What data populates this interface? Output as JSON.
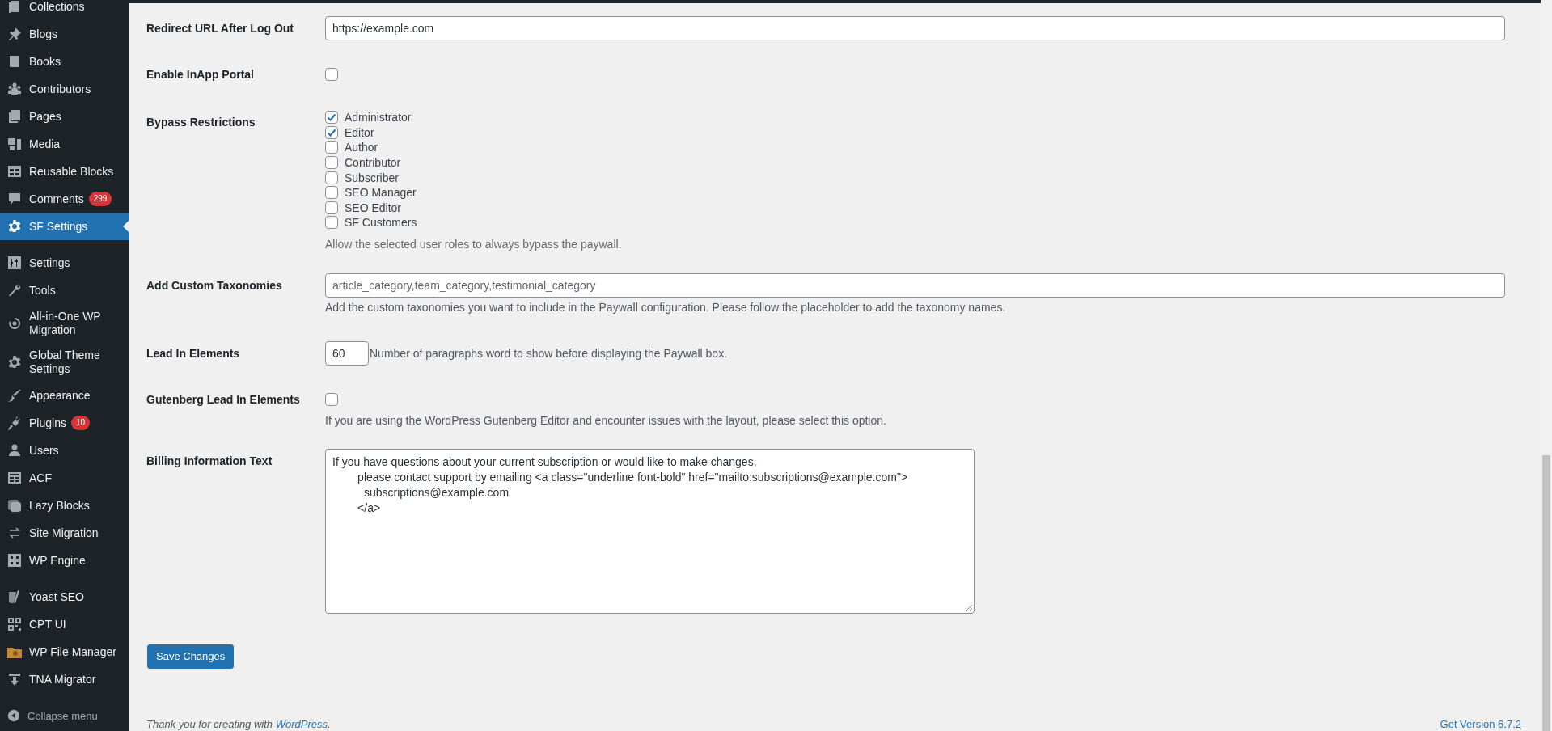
{
  "sidebar": {
    "sections": [
      {
        "items": [
          {
            "label": "Collections",
            "selected": false
          },
          {
            "label": "Blogs",
            "selected": false
          },
          {
            "label": "Books",
            "selected": false
          },
          {
            "label": "Contributors",
            "selected": false
          },
          {
            "label": "Pages",
            "selected": false
          },
          {
            "label": "Media",
            "selected": false
          },
          {
            "label": "Reusable Blocks",
            "selected": false
          },
          {
            "label": "Comments",
            "selected": false,
            "badge": "299"
          },
          {
            "label": "SF Settings",
            "selected": true
          }
        ]
      },
      {
        "items": [
          {
            "label": "Settings",
            "selected": false
          },
          {
            "label": "Tools",
            "selected": false
          },
          {
            "label": "All-in-One WP Migration",
            "selected": false
          },
          {
            "label": "Global Theme Settings",
            "selected": false
          },
          {
            "label": "Appearance",
            "selected": false
          },
          {
            "label": "Plugins",
            "selected": false,
            "badge": "10"
          },
          {
            "label": "Users",
            "selected": false
          },
          {
            "label": "ACF",
            "selected": false
          },
          {
            "label": "Lazy Blocks",
            "selected": false
          },
          {
            "label": "Site Migration",
            "selected": false
          },
          {
            "label": "WP Engine",
            "selected": false
          }
        ]
      },
      {
        "items": [
          {
            "label": "Yoast SEO",
            "selected": false
          },
          {
            "label": "CPT UI",
            "selected": false
          },
          {
            "label": "WP File Manager",
            "selected": false
          },
          {
            "label": "TNA Migrator",
            "selected": false
          }
        ]
      }
    ],
    "collapse_label": "Collapse menu"
  },
  "form": {
    "rows": [
      {
        "kind": "text",
        "label": "Redirect URL After Log Out",
        "value": "https://example.com"
      },
      {
        "kind": "checkbox",
        "label": "Enable InApp Portal",
        "checked": false
      },
      {
        "kind": "checklist",
        "label": "Bypass Restrictions",
        "options": [
          {
            "label": "Administrator",
            "checked": true
          },
          {
            "label": "Editor",
            "checked": true
          },
          {
            "label": "Author",
            "checked": false
          },
          {
            "label": "Contributor",
            "checked": false
          },
          {
            "label": "Subscriber",
            "checked": false
          },
          {
            "label": "SEO Manager",
            "checked": false
          },
          {
            "label": "SEO Editor",
            "checked": false
          },
          {
            "label": "SF Customers",
            "checked": false
          }
        ],
        "description": "Allow the selected user roles to always bypass the paywall."
      },
      {
        "kind": "text",
        "label": "Add Custom Taxonomies",
        "placeholder": "article_category,team_category,testimonial_category",
        "description": "Add the custom taxonomies you want to include in the Paywall configuration. Please follow the placeholder to add the taxonomy names."
      },
      {
        "kind": "number",
        "label": "Lead In Elements",
        "value": "60",
        "description": "Number of paragraphs word to show before displaying the Paywall box."
      },
      {
        "kind": "checkbox",
        "label": "Gutenberg Lead In Elements",
        "checked": false,
        "description": "If you are using the WordPress Gutenberg Editor and encounter issues with the layout, please select this option."
      },
      {
        "kind": "textarea",
        "label": "Billing Information Text",
        "value": "If you have questions about your current subscription or would like to make changes,\n        please contact support by emailing <a class=\"underline font-bold\" href=\"mailto:subscriptions@example.com\">\n          subscriptions@example.com\n        </a>"
      }
    ],
    "submit": "Save Changes"
  },
  "footer": {
    "credit_before": "Thank you for creating with ",
    "credit_link": "WordPress",
    "credit_after": ".",
    "version": "Get Version 6.7.2"
  }
}
